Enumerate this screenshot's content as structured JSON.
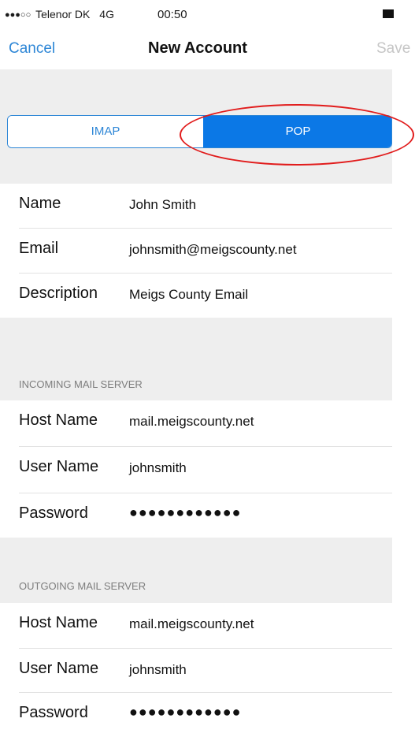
{
  "status_bar": {
    "signal": "●●●○○",
    "carrier": "Telenor DK",
    "network": "4G",
    "time": "00:50"
  },
  "nav": {
    "cancel_label": "Cancel",
    "title": "New Account",
    "save_label": "Save"
  },
  "segmented": {
    "options": [
      "IMAP",
      "POP"
    ],
    "selected": "POP"
  },
  "account": {
    "name_label": "Name",
    "name_value": "John Smith",
    "email_label": "Email",
    "email_value": "johnsmith@meigscounty.net",
    "description_label": "Description",
    "description_value": "Meigs County Email"
  },
  "incoming": {
    "header": "INCOMING MAIL SERVER",
    "host_label": "Host Name",
    "host_value": "mail.meigscounty.net",
    "user_label": "User Name",
    "user_value": "johnsmith",
    "password_label": "Password",
    "password_value": "●●●●●●●●●●●●"
  },
  "outgoing": {
    "header": "OUTGOING MAIL SERVER",
    "host_label": "Host Name",
    "host_value": "mail.meigscounty.net",
    "user_label": "User Name",
    "user_value": "johnsmith",
    "password_label": "Password",
    "password_value": "●●●●●●●●●●●●"
  },
  "colors": {
    "accent": "#2d86d6",
    "selected_segment": "#0b78e6",
    "annotation_ring": "#e11c1c",
    "group_background": "#eeeeee"
  }
}
